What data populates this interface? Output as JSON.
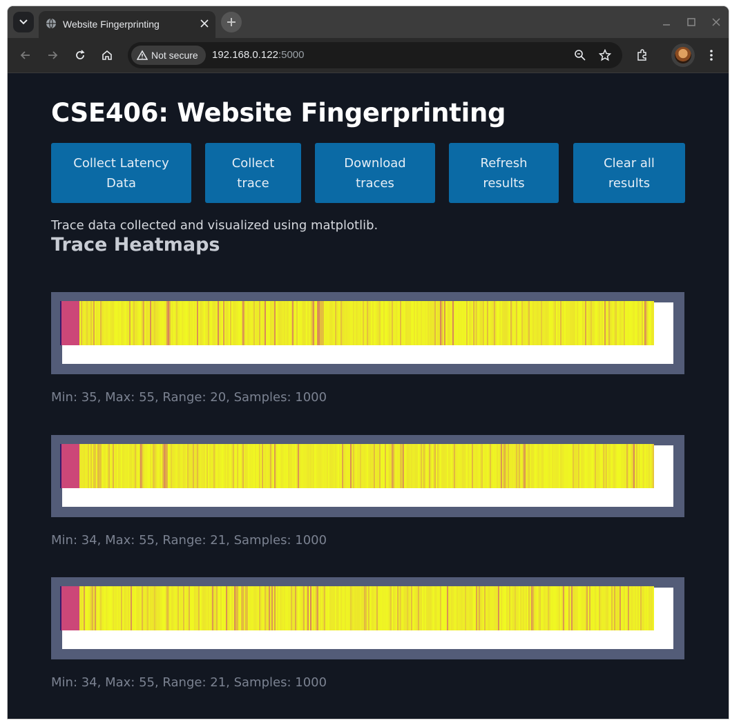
{
  "browser": {
    "tab_title": "Website Fingerprinting",
    "security_label": "Not secure",
    "url_host": "192.168.0.122",
    "url_port": ":5000"
  },
  "page": {
    "title": "CSE406: Website Fingerprinting",
    "buttons": [
      {
        "label": "Collect Latency\nData"
      },
      {
        "label": "Collect\ntrace"
      },
      {
        "label": "Download\ntraces"
      },
      {
        "label": "Refresh\nresults"
      },
      {
        "label": "Clear all\nresults"
      }
    ],
    "status": "Trace data collected and visualized using matplotlib.",
    "section_title": "Trace Heatmaps",
    "heatmaps": [
      {
        "stats": "Min: 35, Max: 55, Range: 20, Samples: 1000",
        "min": 35,
        "max": 55,
        "samples": 1000
      },
      {
        "stats": "Min: 34, Max: 55, Range: 21, Samples: 1000",
        "min": 34,
        "max": 55,
        "samples": 1000
      },
      {
        "stats": "Min: 34, Max: 55, Range: 21, Samples: 1000",
        "min": 34,
        "max": 55,
        "samples": 1000
      }
    ]
  },
  "colors": {
    "page_bg": "#121721",
    "button_bg": "#0b6aa5",
    "heatmap_frame": "#535c78",
    "heatmap_low": "#cc4778",
    "heatmap_high": "#f0f921"
  },
  "icons": [
    "tab-search-icon",
    "globe-icon",
    "close-icon",
    "plus-icon",
    "minimize-icon",
    "maximize-icon",
    "window-close-icon",
    "back-icon",
    "forward-icon",
    "reload-icon",
    "home-icon",
    "warning-icon",
    "zoom-icon",
    "star-icon",
    "extensions-icon",
    "menu-icon"
  ]
}
